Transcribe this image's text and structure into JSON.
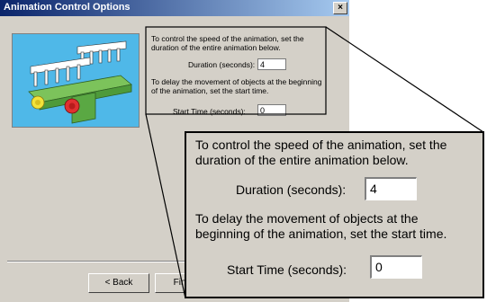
{
  "window": {
    "title": "Animation Control Options",
    "close_glyph": "×"
  },
  "dialog": {
    "speed_text": "To control the speed of the animation, set the duration of the entire animation below.",
    "duration_label": "Duration (seconds):",
    "duration_value": "4",
    "delay_text": "To delay the movement of objects at the beginning of the animation, set the start time.",
    "start_label": "Start Time (seconds):",
    "start_value": "0"
  },
  "buttons": {
    "back": "< Back",
    "finish": "Finish"
  },
  "zoom": {
    "speed_line1": "To control the speed of the animation, set the",
    "speed_line2": "duration of the entire animation below.",
    "duration_label": "Duration (seconds):",
    "duration_value": "4",
    "delay_line1": "To delay the movement of objects at the",
    "delay_line2": "beginning of the animation, set the start time.",
    "start_label": "Start Time (seconds):",
    "start_value": "0"
  },
  "icons": {
    "preview": "mechanical-assembly-image"
  },
  "colors": {
    "title_start": "#0a246a",
    "title_end": "#a6caf0",
    "dialog_bg": "#d4d0c8",
    "preview_bg": "#4fb8e8"
  }
}
